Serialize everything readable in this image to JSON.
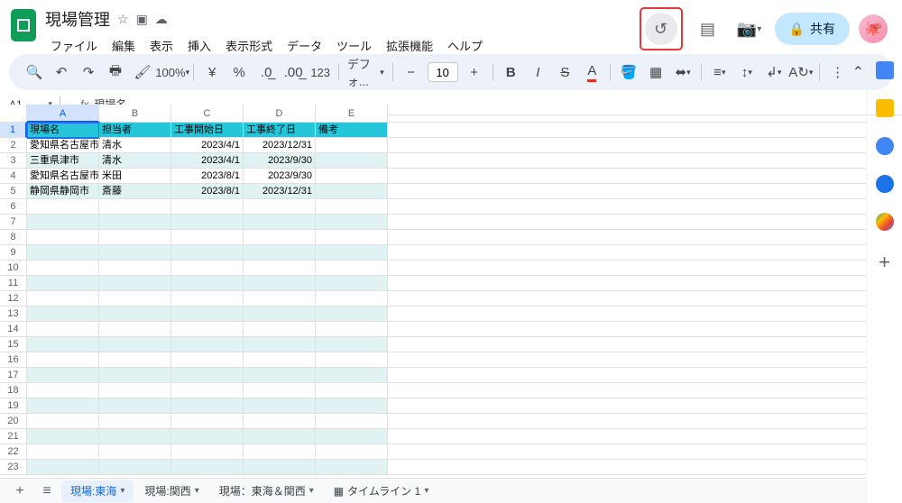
{
  "doc": {
    "title": "現場管理"
  },
  "menus": [
    "ファイル",
    "編集",
    "表示",
    "挿入",
    "表示形式",
    "データ",
    "ツール",
    "拡張機能",
    "ヘルプ"
  ],
  "share": {
    "label": "共有"
  },
  "toolbar": {
    "zoom": "100%",
    "font": "デフォ...",
    "font_size": "10"
  },
  "namebox": {
    "ref": "A1",
    "formula": "現場名"
  },
  "columns": [
    "A",
    "B",
    "C",
    "D",
    "E"
  ],
  "header_row": [
    "現場名",
    "担当者",
    "工事開始日",
    "工事終了日",
    "備考"
  ],
  "rows": [
    [
      "愛知県名古屋市",
      "清水",
      "2023/4/1",
      "2023/12/31",
      ""
    ],
    [
      "三重県津市",
      "清水",
      "2023/4/1",
      "2023/9/30",
      ""
    ],
    [
      "愛知県名古屋市",
      "米田",
      "2023/8/1",
      "2023/9/30",
      ""
    ],
    [
      "静岡県静岡市",
      "斎藤",
      "2023/8/1",
      "2023/12/31",
      ""
    ]
  ],
  "sheets": [
    {
      "name": "現場:東海",
      "active": true
    },
    {
      "name": "現場:関西",
      "active": false
    },
    {
      "name": "現場：東海＆関西",
      "active": false
    },
    {
      "name": "タイムライン 1",
      "active": false,
      "icon": true
    }
  ],
  "active_cell": "A1"
}
